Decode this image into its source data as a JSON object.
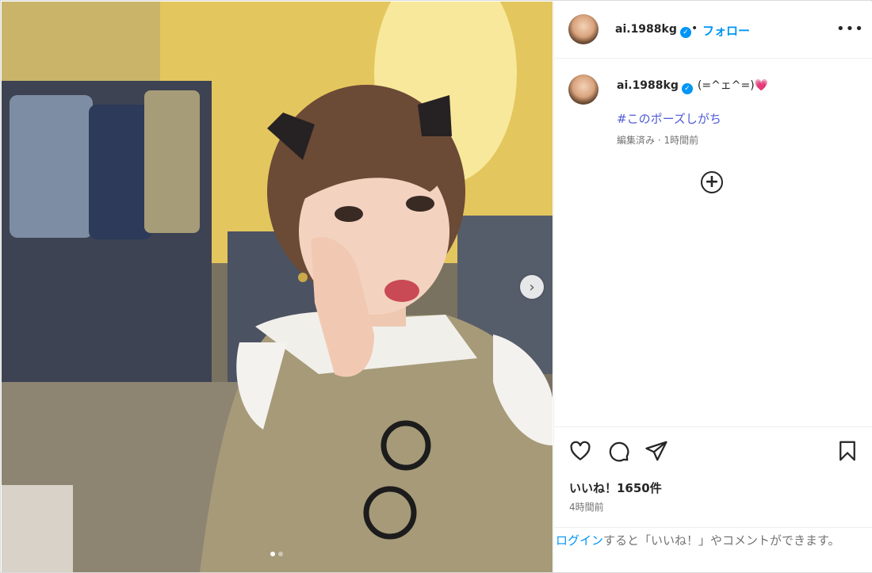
{
  "post": {
    "username": "ai.1988kg",
    "follow_label": "フォロー",
    "separator": "•",
    "more_label": "•••",
    "verified_mark": "✓",
    "caption_text": "(=^ェ^=)",
    "caption_emoji": "💗",
    "hashtag": "#このポーズしがち",
    "meta": "編集済み · 1時間前",
    "add_comment_symbol": "+",
    "likes": "いいね！1650件",
    "time": "4時間前",
    "login_link": "ログイン",
    "login_rest": "すると「いいね！」やコメントができます。",
    "next_arrow": "›"
  },
  "carousel": {
    "current": 1,
    "total": 2
  },
  "icons": {
    "like": "heart-icon",
    "comment": "comment-icon",
    "share": "paper-plane-icon",
    "save": "bookmark-icon"
  },
  "colors": {
    "accent": "#0095f6",
    "hashtag": "#4f5bd5",
    "secondary": "#737373"
  }
}
